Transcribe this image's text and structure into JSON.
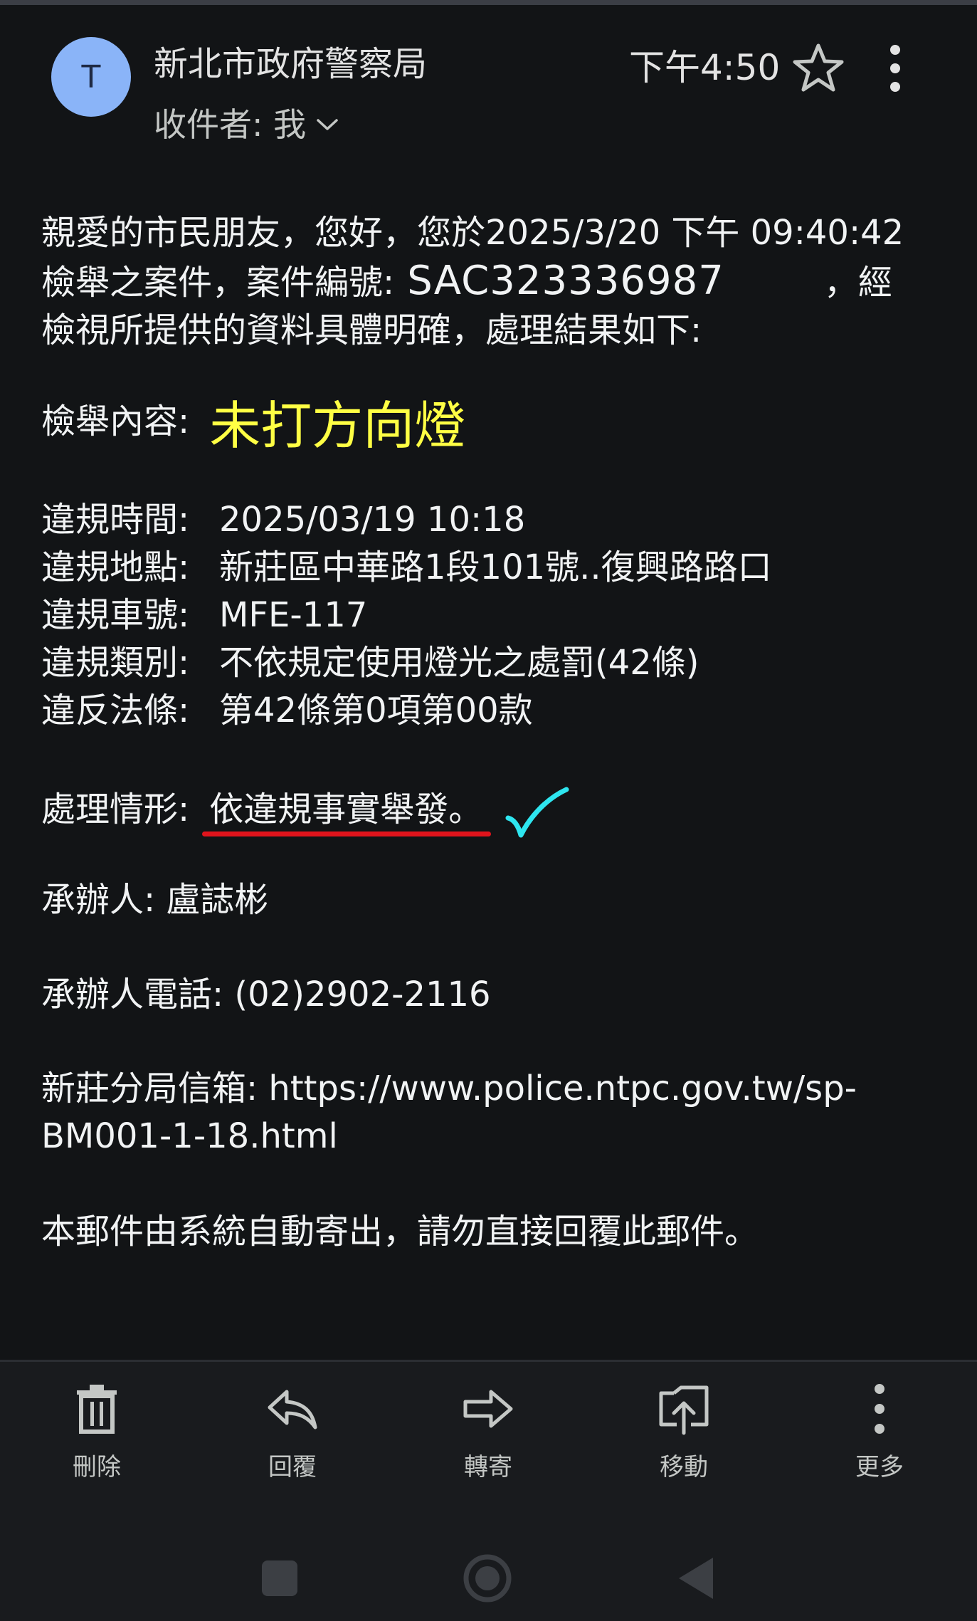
{
  "header": {
    "avatar_letter": "T",
    "sender": "新北市政府警察局",
    "recipient": "收件者: 我",
    "time": "下午4:50"
  },
  "body": {
    "intro_line1": "親愛的市民朋友，您好，您於2025/3/20 下午 09:40:42",
    "intro_line2_prefix": "檢舉之案件，案件編號:",
    "case_number": "SAC323336987",
    "intro_line2_suffix": "，經",
    "intro_line3": "檢視所提供的資料具體明確，處理結果如下:",
    "content_label": "檢舉內容:",
    "content_value": "未打方向燈",
    "details": [
      {
        "label": "違規時間:",
        "value": "2025/03/19 10:18"
      },
      {
        "label": "違規地點:",
        "value": "新莊區中華路1段101號..復興路路口"
      },
      {
        "label": "違規車號:",
        "value": "MFE-117"
      },
      {
        "label": "違規類別:",
        "value": "不依規定使用燈光之處罰(42條)"
      },
      {
        "label": "違反法條:",
        "value": "第42條第0項第00款"
      }
    ],
    "handling_label": "處理情形:",
    "handling_value": "依違規事實舉發。",
    "handler": "承辦人:  盧誌彬",
    "phone": "承辦人電話:  (02)2902-2116",
    "mailbox_line1": "新莊分局信箱:  https://www.police.ntpc.gov.tw/sp-",
    "mailbox_line2": "BM001-1-18.html",
    "footer_note": "本郵件由系統自動寄出，請勿直接回覆此郵件。"
  },
  "actions": {
    "delete": "刪除",
    "reply": "回覆",
    "forward": "轉寄",
    "move": "移動",
    "more": "更多"
  },
  "colors": {
    "background": "#121416",
    "highlight_yellow": "#ffff44",
    "underline_red": "#e0141c",
    "check_cyan": "#2ee6f0"
  }
}
